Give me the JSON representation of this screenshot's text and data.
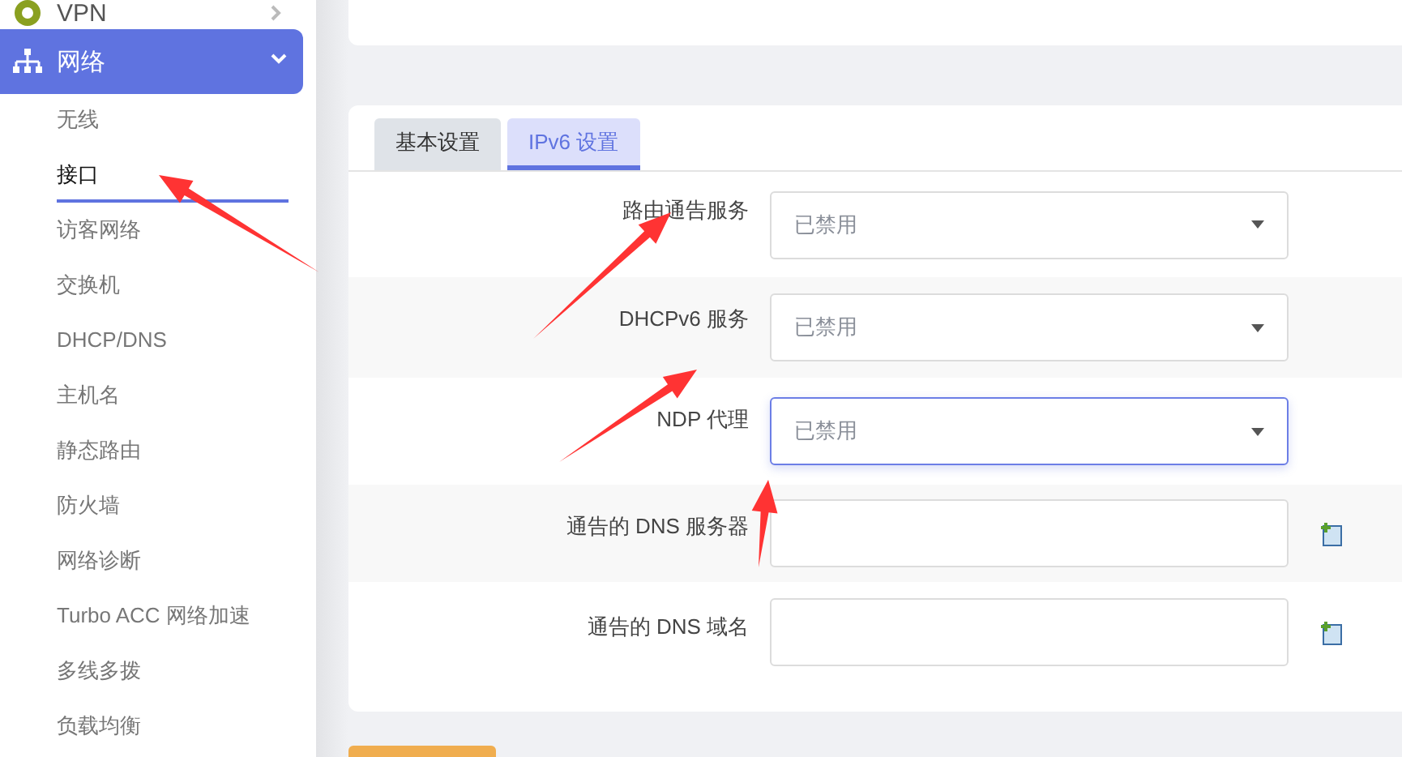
{
  "sidebar": {
    "groups": [
      {
        "label": "VPN",
        "expanded": false,
        "selected": false
      },
      {
        "label": "网络",
        "expanded": true,
        "selected": true,
        "children": [
          {
            "label": "无线",
            "selected": false
          },
          {
            "label": "接口",
            "selected": true
          },
          {
            "label": "访客网络",
            "selected": false
          },
          {
            "label": "交换机",
            "selected": false
          },
          {
            "label": "DHCP/DNS",
            "selected": false
          },
          {
            "label": "主机名",
            "selected": false
          },
          {
            "label": "静态路由",
            "selected": false
          },
          {
            "label": "防火墙",
            "selected": false
          },
          {
            "label": "网络诊断",
            "selected": false
          },
          {
            "label": "Turbo ACC 网络加速",
            "selected": false
          },
          {
            "label": "多线多拨",
            "selected": false
          },
          {
            "label": "负载均衡",
            "selected": false
          }
        ]
      }
    ]
  },
  "tabs": [
    {
      "label": "基本设置",
      "selected": false
    },
    {
      "label": "IPv6 设置",
      "selected": true
    }
  ],
  "fields": [
    {
      "label": "路由通告服务",
      "kind": "select",
      "value": "已禁用",
      "focused": false
    },
    {
      "label": "DHCPv6 服务",
      "kind": "select",
      "value": "已禁用",
      "focused": false
    },
    {
      "label": "NDP 代理",
      "kind": "select",
      "value": "已禁用",
      "focused": true
    },
    {
      "label": "通告的 DNS 服务器",
      "kind": "list"
    },
    {
      "label": "通告的 DNS 域名",
      "kind": "list"
    }
  ]
}
